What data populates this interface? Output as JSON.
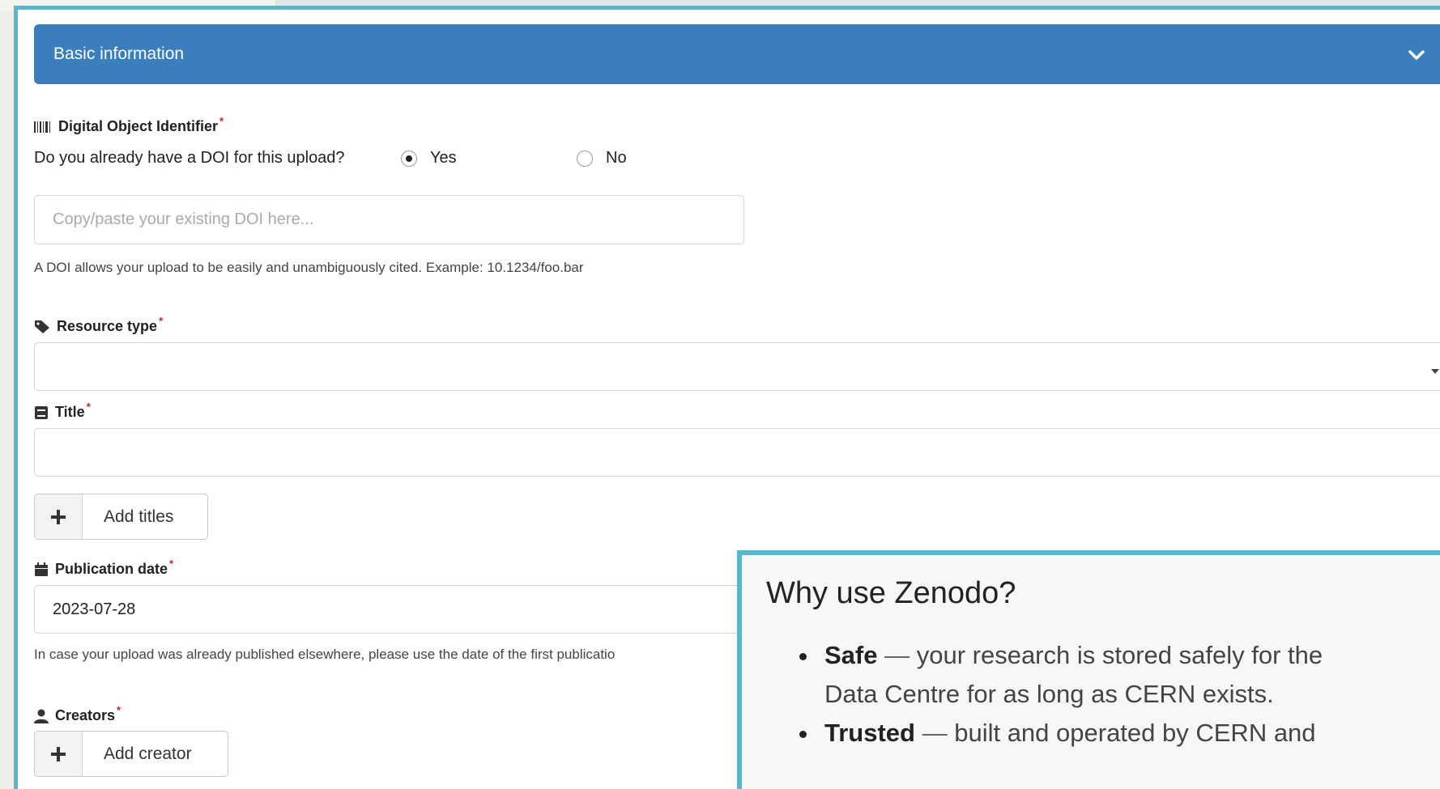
{
  "panel": {
    "title": "Basic information",
    "toggle_icon": "chevron-down-icon"
  },
  "doi": {
    "label": "Digital Object Identifier",
    "required_mark": "*",
    "question": "Do you already have a DOI for this upload?",
    "options": [
      "Yes",
      "No"
    ],
    "selected": "Yes",
    "placeholder": "Copy/paste your existing DOI here...",
    "value": "",
    "help": "A DOI allows your upload to be easily and unambiguously cited. Example: 10.1234/foo.bar",
    "icon": "barcode-icon"
  },
  "resource_type": {
    "label": "Resource type",
    "required_mark": "*",
    "value": "",
    "icon": "tag-icon"
  },
  "title_field": {
    "label": "Title",
    "required_mark": "*",
    "value": "",
    "icon": "book-icon"
  },
  "add_titles_button": {
    "label": "Add titles",
    "icon": "plus-icon"
  },
  "publication_date": {
    "label": "Publication date",
    "required_mark": "*",
    "value": "2023-07-28",
    "help": "In case your upload was already published elsewhere, please use the date of the first publicatio",
    "icon": "calendar-icon"
  },
  "creators": {
    "label": "Creators",
    "required_mark": "*",
    "icon": "user-icon"
  },
  "add_creator_button": {
    "label": "Add creator",
    "icon": "plus-icon"
  },
  "why_zenodo": {
    "heading": "Why use Zenodo?",
    "items": [
      {
        "title": "Safe",
        "dash": "—",
        "text": " your research is stored safely for the",
        "cont": "Data Centre for as long as CERN exists."
      },
      {
        "title": "Trusted",
        "dash": "—",
        "text": " built and operated by CERN and"
      }
    ]
  },
  "colors": {
    "header_blue": "#3a7ebd",
    "frame_teal": "#5ab7c9",
    "required_red": "#d21f1f"
  }
}
